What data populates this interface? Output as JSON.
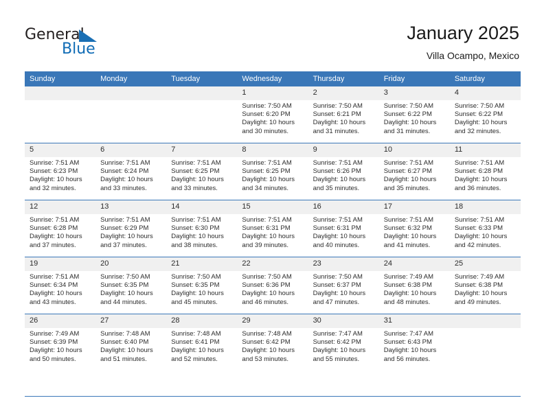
{
  "brand": {
    "name_part1": "General",
    "name_part2": "Blue",
    "accent_color": "#1a6fb4"
  },
  "header": {
    "title": "January 2025",
    "subtitle": "Villa Ocampo, Mexico"
  },
  "calendar": {
    "header_bg": "#3a77b8",
    "daynum_bg": "#f0f0f0",
    "columns": [
      "Sunday",
      "Monday",
      "Tuesday",
      "Wednesday",
      "Thursday",
      "Friday",
      "Saturday"
    ],
    "labels": {
      "sunrise": "Sunrise:",
      "sunset": "Sunset:",
      "daylight": "Daylight:"
    },
    "weeks": [
      [
        {
          "day": "",
          "sunrise": "",
          "sunset": "",
          "daylight_line1": "",
          "daylight_line2": ""
        },
        {
          "day": "",
          "sunrise": "",
          "sunset": "",
          "daylight_line1": "",
          "daylight_line2": ""
        },
        {
          "day": "",
          "sunrise": "",
          "sunset": "",
          "daylight_line1": "",
          "daylight_line2": ""
        },
        {
          "day": "1",
          "sunrise": "Sunrise: 7:50 AM",
          "sunset": "Sunset: 6:20 PM",
          "daylight_line1": "Daylight: 10 hours",
          "daylight_line2": "and 30 minutes."
        },
        {
          "day": "2",
          "sunrise": "Sunrise: 7:50 AM",
          "sunset": "Sunset: 6:21 PM",
          "daylight_line1": "Daylight: 10 hours",
          "daylight_line2": "and 31 minutes."
        },
        {
          "day": "3",
          "sunrise": "Sunrise: 7:50 AM",
          "sunset": "Sunset: 6:22 PM",
          "daylight_line1": "Daylight: 10 hours",
          "daylight_line2": "and 31 minutes."
        },
        {
          "day": "4",
          "sunrise": "Sunrise: 7:50 AM",
          "sunset": "Sunset: 6:22 PM",
          "daylight_line1": "Daylight: 10 hours",
          "daylight_line2": "and 32 minutes."
        }
      ],
      [
        {
          "day": "5",
          "sunrise": "Sunrise: 7:51 AM",
          "sunset": "Sunset: 6:23 PM",
          "daylight_line1": "Daylight: 10 hours",
          "daylight_line2": "and 32 minutes."
        },
        {
          "day": "6",
          "sunrise": "Sunrise: 7:51 AM",
          "sunset": "Sunset: 6:24 PM",
          "daylight_line1": "Daylight: 10 hours",
          "daylight_line2": "and 33 minutes."
        },
        {
          "day": "7",
          "sunrise": "Sunrise: 7:51 AM",
          "sunset": "Sunset: 6:25 PM",
          "daylight_line1": "Daylight: 10 hours",
          "daylight_line2": "and 33 minutes."
        },
        {
          "day": "8",
          "sunrise": "Sunrise: 7:51 AM",
          "sunset": "Sunset: 6:25 PM",
          "daylight_line1": "Daylight: 10 hours",
          "daylight_line2": "and 34 minutes."
        },
        {
          "day": "9",
          "sunrise": "Sunrise: 7:51 AM",
          "sunset": "Sunset: 6:26 PM",
          "daylight_line1": "Daylight: 10 hours",
          "daylight_line2": "and 35 minutes."
        },
        {
          "day": "10",
          "sunrise": "Sunrise: 7:51 AM",
          "sunset": "Sunset: 6:27 PM",
          "daylight_line1": "Daylight: 10 hours",
          "daylight_line2": "and 35 minutes."
        },
        {
          "day": "11",
          "sunrise": "Sunrise: 7:51 AM",
          "sunset": "Sunset: 6:28 PM",
          "daylight_line1": "Daylight: 10 hours",
          "daylight_line2": "and 36 minutes."
        }
      ],
      [
        {
          "day": "12",
          "sunrise": "Sunrise: 7:51 AM",
          "sunset": "Sunset: 6:28 PM",
          "daylight_line1": "Daylight: 10 hours",
          "daylight_line2": "and 37 minutes."
        },
        {
          "day": "13",
          "sunrise": "Sunrise: 7:51 AM",
          "sunset": "Sunset: 6:29 PM",
          "daylight_line1": "Daylight: 10 hours",
          "daylight_line2": "and 37 minutes."
        },
        {
          "day": "14",
          "sunrise": "Sunrise: 7:51 AM",
          "sunset": "Sunset: 6:30 PM",
          "daylight_line1": "Daylight: 10 hours",
          "daylight_line2": "and 38 minutes."
        },
        {
          "day": "15",
          "sunrise": "Sunrise: 7:51 AM",
          "sunset": "Sunset: 6:31 PM",
          "daylight_line1": "Daylight: 10 hours",
          "daylight_line2": "and 39 minutes."
        },
        {
          "day": "16",
          "sunrise": "Sunrise: 7:51 AM",
          "sunset": "Sunset: 6:31 PM",
          "daylight_line1": "Daylight: 10 hours",
          "daylight_line2": "and 40 minutes."
        },
        {
          "day": "17",
          "sunrise": "Sunrise: 7:51 AM",
          "sunset": "Sunset: 6:32 PM",
          "daylight_line1": "Daylight: 10 hours",
          "daylight_line2": "and 41 minutes."
        },
        {
          "day": "18",
          "sunrise": "Sunrise: 7:51 AM",
          "sunset": "Sunset: 6:33 PM",
          "daylight_line1": "Daylight: 10 hours",
          "daylight_line2": "and 42 minutes."
        }
      ],
      [
        {
          "day": "19",
          "sunrise": "Sunrise: 7:51 AM",
          "sunset": "Sunset: 6:34 PM",
          "daylight_line1": "Daylight: 10 hours",
          "daylight_line2": "and 43 minutes."
        },
        {
          "day": "20",
          "sunrise": "Sunrise: 7:50 AM",
          "sunset": "Sunset: 6:35 PM",
          "daylight_line1": "Daylight: 10 hours",
          "daylight_line2": "and 44 minutes."
        },
        {
          "day": "21",
          "sunrise": "Sunrise: 7:50 AM",
          "sunset": "Sunset: 6:35 PM",
          "daylight_line1": "Daylight: 10 hours",
          "daylight_line2": "and 45 minutes."
        },
        {
          "day": "22",
          "sunrise": "Sunrise: 7:50 AM",
          "sunset": "Sunset: 6:36 PM",
          "daylight_line1": "Daylight: 10 hours",
          "daylight_line2": "and 46 minutes."
        },
        {
          "day": "23",
          "sunrise": "Sunrise: 7:50 AM",
          "sunset": "Sunset: 6:37 PM",
          "daylight_line1": "Daylight: 10 hours",
          "daylight_line2": "and 47 minutes."
        },
        {
          "day": "24",
          "sunrise": "Sunrise: 7:49 AM",
          "sunset": "Sunset: 6:38 PM",
          "daylight_line1": "Daylight: 10 hours",
          "daylight_line2": "and 48 minutes."
        },
        {
          "day": "25",
          "sunrise": "Sunrise: 7:49 AM",
          "sunset": "Sunset: 6:38 PM",
          "daylight_line1": "Daylight: 10 hours",
          "daylight_line2": "and 49 minutes."
        }
      ],
      [
        {
          "day": "26",
          "sunrise": "Sunrise: 7:49 AM",
          "sunset": "Sunset: 6:39 PM",
          "daylight_line1": "Daylight: 10 hours",
          "daylight_line2": "and 50 minutes."
        },
        {
          "day": "27",
          "sunrise": "Sunrise: 7:48 AM",
          "sunset": "Sunset: 6:40 PM",
          "daylight_line1": "Daylight: 10 hours",
          "daylight_line2": "and 51 minutes."
        },
        {
          "day": "28",
          "sunrise": "Sunrise: 7:48 AM",
          "sunset": "Sunset: 6:41 PM",
          "daylight_line1": "Daylight: 10 hours",
          "daylight_line2": "and 52 minutes."
        },
        {
          "day": "29",
          "sunrise": "Sunrise: 7:48 AM",
          "sunset": "Sunset: 6:42 PM",
          "daylight_line1": "Daylight: 10 hours",
          "daylight_line2": "and 53 minutes."
        },
        {
          "day": "30",
          "sunrise": "Sunrise: 7:47 AM",
          "sunset": "Sunset: 6:42 PM",
          "daylight_line1": "Daylight: 10 hours",
          "daylight_line2": "and 55 minutes."
        },
        {
          "day": "31",
          "sunrise": "Sunrise: 7:47 AM",
          "sunset": "Sunset: 6:43 PM",
          "daylight_line1": "Daylight: 10 hours",
          "daylight_line2": "and 56 minutes."
        },
        {
          "day": "",
          "sunrise": "",
          "sunset": "",
          "daylight_line1": "",
          "daylight_line2": ""
        }
      ]
    ]
  }
}
